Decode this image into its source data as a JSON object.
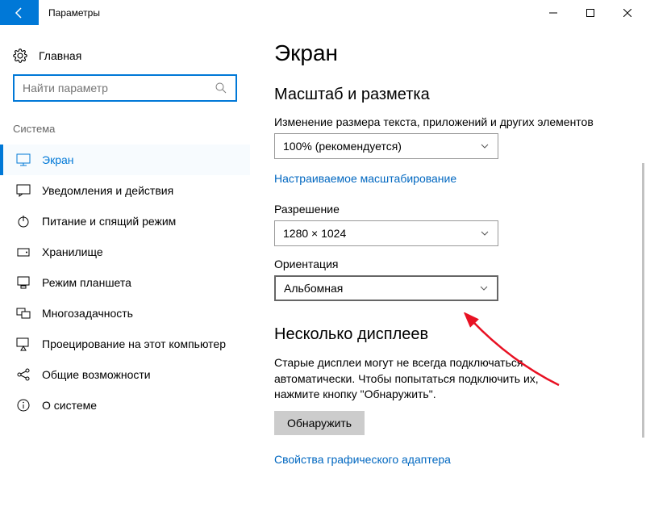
{
  "titlebar": {
    "title": "Параметры"
  },
  "sidebar": {
    "home_label": "Главная",
    "search_placeholder": "Найти параметр",
    "category_label": "Система",
    "items": [
      {
        "label": "Экран"
      },
      {
        "label": "Уведомления и действия"
      },
      {
        "label": "Питание и спящий режим"
      },
      {
        "label": "Хранилище"
      },
      {
        "label": "Режим планшета"
      },
      {
        "label": "Многозадачность"
      },
      {
        "label": "Проецирование на этот компьютер"
      },
      {
        "label": "Общие возможности"
      },
      {
        "label": "О системе"
      }
    ]
  },
  "main": {
    "h1": "Экран",
    "scale_section": "Масштаб и разметка",
    "scale_label": "Изменение размера текста, приложений и других элементов",
    "scale_value": "100% (рекомендуется)",
    "custom_scale_link": "Настраиваемое масштабирование",
    "resolution_label": "Разрешение",
    "resolution_value": "1280 × 1024",
    "orientation_label": "Ориентация",
    "orientation_value": "Альбомная",
    "multi_section": "Несколько дисплеев",
    "multi_desc": "Старые дисплеи могут не всегда подключаться автоматически. Чтобы попытаться подключить их, нажмите кнопку \"Обнаружить\".",
    "detect_btn": "Обнаружить",
    "gpu_link": "Свойства графического адаптера"
  }
}
